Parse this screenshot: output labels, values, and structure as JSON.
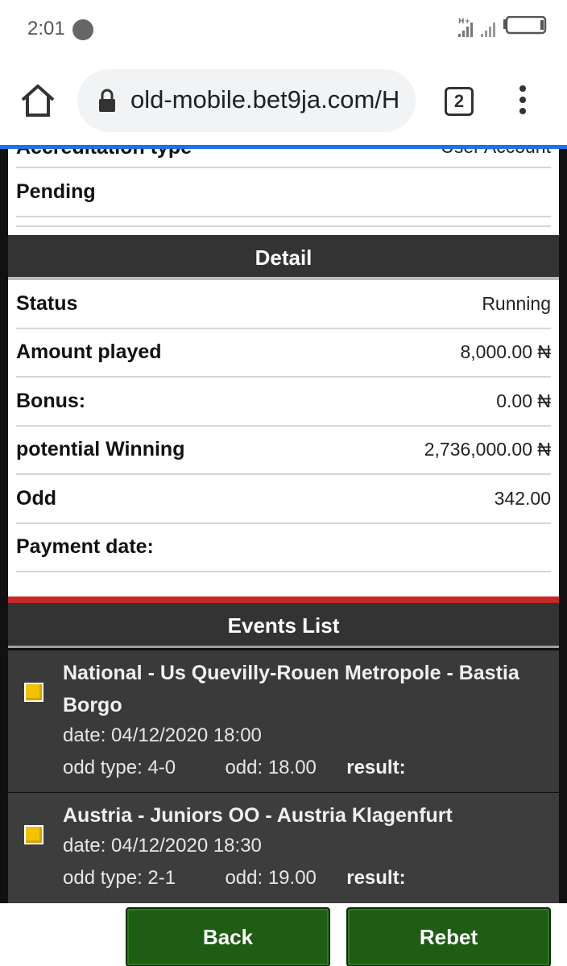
{
  "status_bar": {
    "time": "2:01",
    "icons": [
      "network-hplus-icon",
      "signal-icon",
      "battery-icon"
    ]
  },
  "browser": {
    "url": "old-mobile.bet9ja.com/H",
    "tab_count": "2",
    "icons": [
      "home-icon",
      "lock-icon",
      "more-vert-icon"
    ]
  },
  "top_card": {
    "accreditation_label": "Accreditation type",
    "accreditation_value": "User Account",
    "pending_label": "Pending"
  },
  "detail": {
    "title": "Detail",
    "rows": [
      {
        "label": "Status",
        "value": "Running"
      },
      {
        "label": "Amount played",
        "value": "8,000.00 ₦"
      },
      {
        "label": "Bonus:",
        "value": "0.00 ₦"
      },
      {
        "label": "potential Winning",
        "value": "2,736,000.00 ₦"
      },
      {
        "label": "Odd",
        "value": "342.00"
      },
      {
        "label": "Payment date:",
        "value": ""
      }
    ]
  },
  "events": {
    "title": "Events List",
    "items": [
      {
        "title": "National - Us Quevilly-Rouen Metropole - Bastia Borgo",
        "date": "date: 04/12/2020 18:00",
        "odd_type": "odd type: 4-0",
        "odd": "odd: 18.00",
        "result": "result:"
      },
      {
        "title": "Austria - Juniors OO - Austria Klagenfurt",
        "date": "date: 04/12/2020 18:30",
        "odd_type": "odd type: 2-1",
        "odd": "odd: 19.00",
        "result": "result:"
      }
    ]
  },
  "footer": {
    "back_label": "Back",
    "rebet_label": "Rebet"
  },
  "colors": {
    "button_green": "#1f5c14",
    "section_dark": "#333333",
    "accent_red": "#c62828",
    "marker_yellow": "#f2c200",
    "load_blue": "#1a73e8"
  }
}
